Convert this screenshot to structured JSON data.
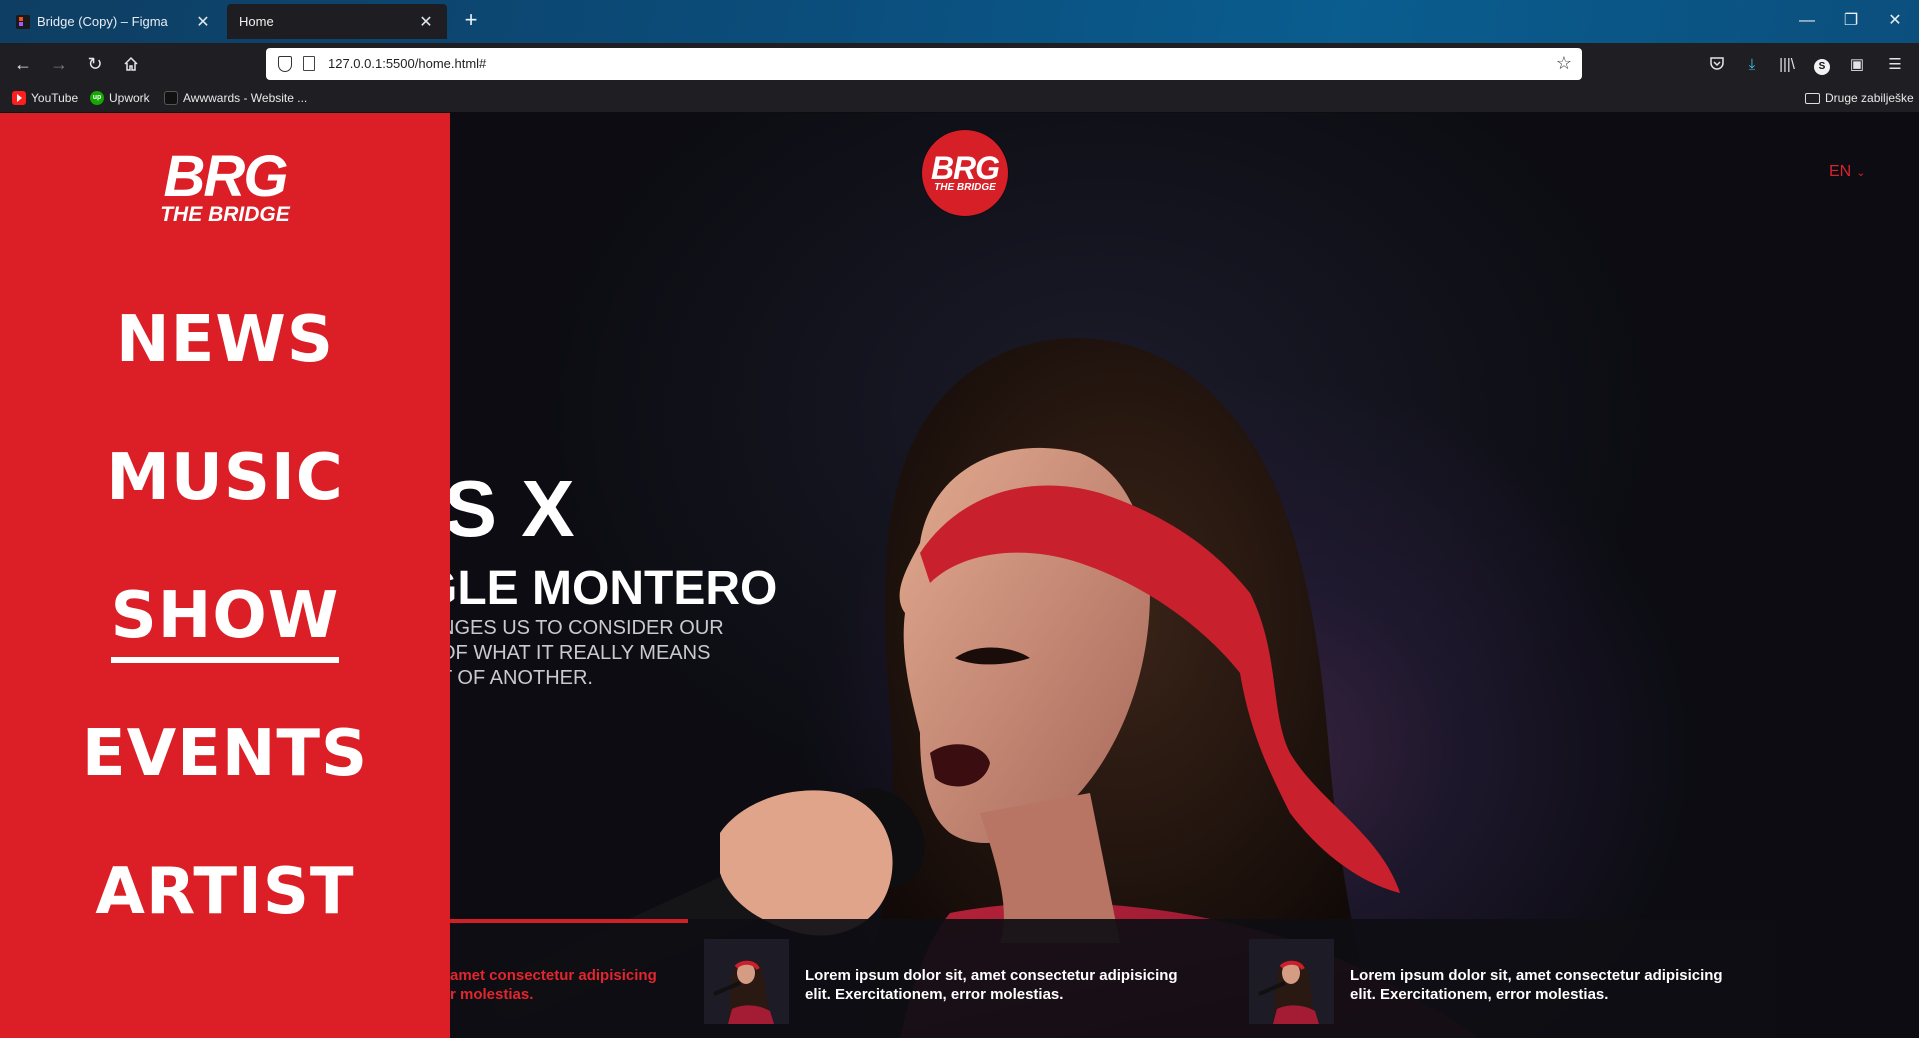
{
  "browser": {
    "tabs": [
      {
        "label": "Bridge (Copy) – Figma",
        "active": false
      },
      {
        "label": "Home",
        "active": true
      }
    ],
    "url": "127.0.0.1:5500/home.html#",
    "bookmarks": [
      "YouTube",
      "Upwork",
      "Awwwards - Website ..."
    ],
    "other_bookmarks": "Druge zabilješke",
    "icons": {
      "back": "arrow-left-icon",
      "forward": "arrow-right-icon",
      "reload": "reload-icon",
      "home": "home-icon",
      "pocket": "pocket-icon",
      "download": "download-icon",
      "library": "library-icon",
      "account": "account-icon",
      "extension": "extension-icon",
      "menu": "hamburger-icon"
    }
  },
  "menu": {
    "logo_main": "BRG",
    "logo_sub": "THE BRIDGE",
    "items": [
      {
        "label": "NEWS",
        "active": false
      },
      {
        "label": "MUSIC",
        "active": false
      },
      {
        "label": "SHOW",
        "active": true
      },
      {
        "label": "EVENTS",
        "active": false
      },
      {
        "label": "ARTIST",
        "active": false
      }
    ]
  },
  "header": {
    "logo_main": "BRG",
    "logo_sub": "THE BRIDGE",
    "language": "EN"
  },
  "hero": {
    "title": "LAS X",
    "subtitle": "GLE MONTERO",
    "description_lines": [
      "NGES US TO CONSIDER OUR",
      "OF WHAT IT REALLY MEANS",
      "T OF ANOTHER."
    ]
  },
  "news": [
    {
      "text_line1": "amet consectetur adipisicing",
      "text_line2": "r molestias.",
      "highlighted": true
    },
    {
      "text_line1": "Lorem ipsum dolor sit, amet consectetur adipisicing",
      "text_line2": "elit. Exercitationem, error molestias.",
      "highlighted": false
    },
    {
      "text_line1": "Lorem ipsum dolor sit, amet consectetur adipisicing",
      "text_line2": "elit. Exercitationem, error molestias.",
      "highlighted": false
    }
  ],
  "colors": {
    "brand_red": "#dc1f26",
    "background": "#0b0b10"
  }
}
